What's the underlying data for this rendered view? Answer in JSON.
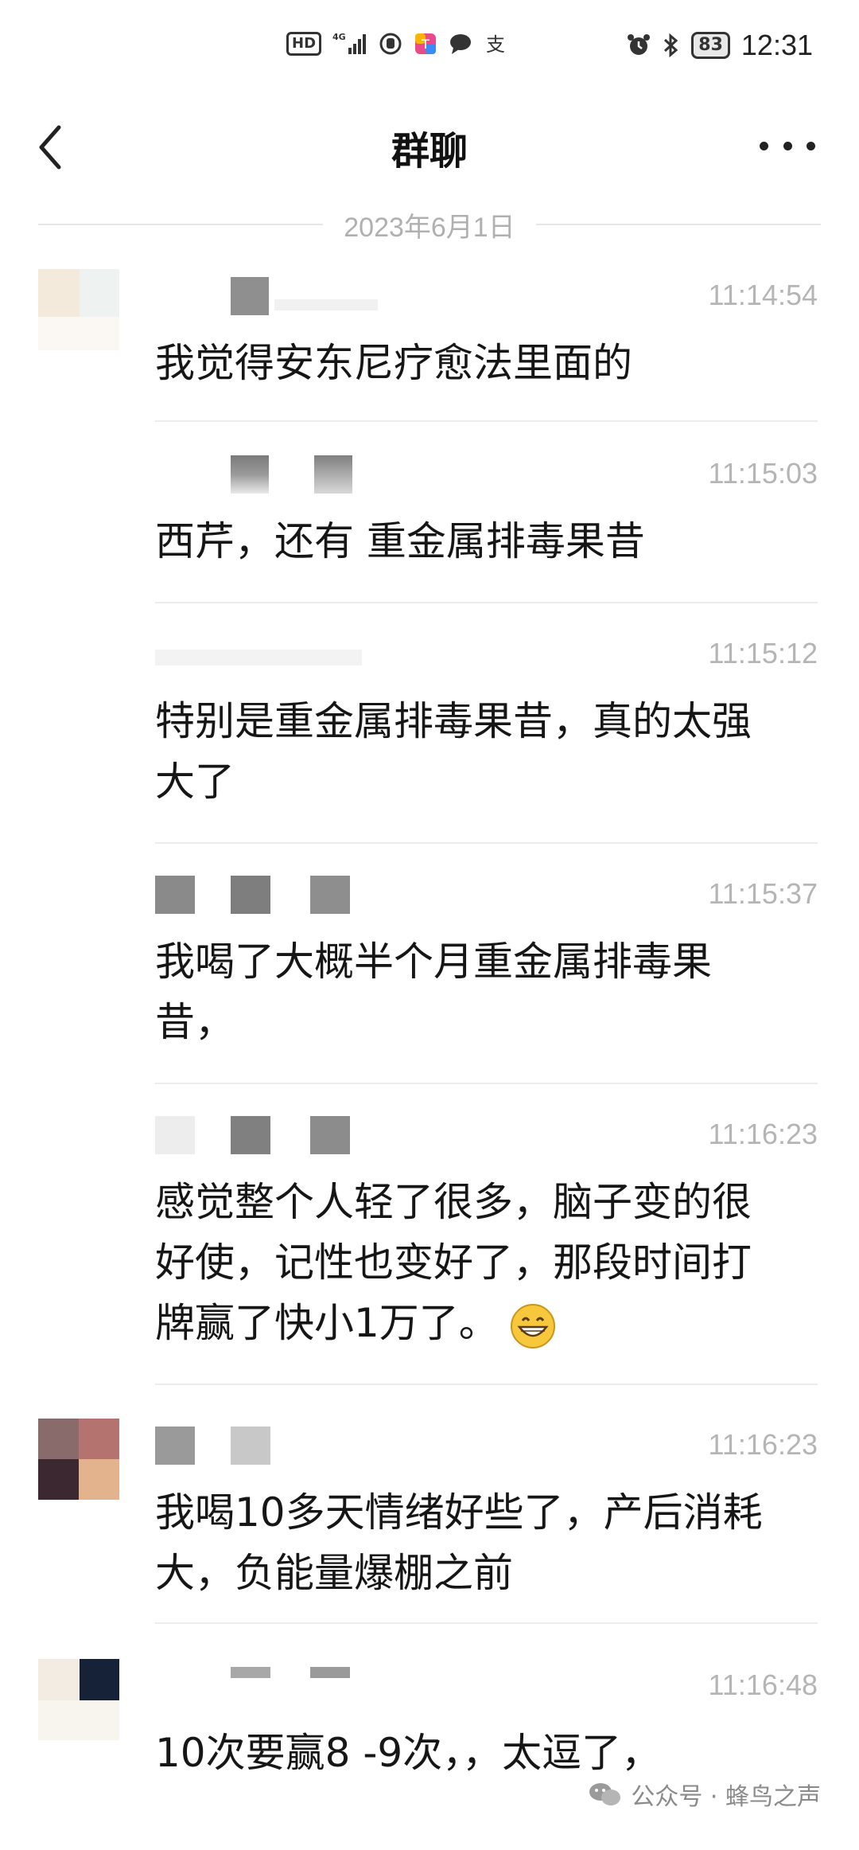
{
  "status_bar": {
    "hd": "HD",
    "network": "4G",
    "battery": "83",
    "time": "12:31",
    "icons": [
      "hd-icon",
      "signal-icon",
      "hand-icon",
      "app-icon",
      "chat-bubble-icon",
      "alipay-icon",
      "alarm-icon",
      "bluetooth-icon",
      "battery-icon"
    ]
  },
  "header": {
    "title": "群聊",
    "back_icon": "chevron-left-icon",
    "more_icon": "more-dots-icon"
  },
  "date_divider": "2023年6月1日",
  "messages": [
    {
      "time": "11:14:54",
      "text": "我觉得安东尼疗愈法里面的"
    },
    {
      "time": "11:15:03",
      "text": "西芹，还有 重金属排毒果昔"
    },
    {
      "time": "11:15:12",
      "text": "特别是重金属排毒果昔，真的太强\n大了"
    },
    {
      "time": "11:15:37",
      "text": "我喝了大概半个月重金属排毒果\n昔，"
    },
    {
      "time": "11:16:23",
      "text": "感觉整个人轻了很多，脑子变的很\n好使，记性也变好了，那段时间打\n牌赢了快小1万了。",
      "emoji": "grinning-face-icon"
    },
    {
      "time": "11:16:23",
      "text": "我喝10多天情绪好些了，产后消耗\n大，负能量爆棚之前"
    },
    {
      "time": "11:16:48",
      "text": "10次要赢8 -9次，，太逗了，"
    }
  ],
  "watermark": {
    "text": "公众号 · 蜂鸟之声",
    "icon": "wechat-icon"
  },
  "colors": {
    "time_text": "#b5b5b5",
    "divider": "#ececec",
    "text": "#161616"
  }
}
